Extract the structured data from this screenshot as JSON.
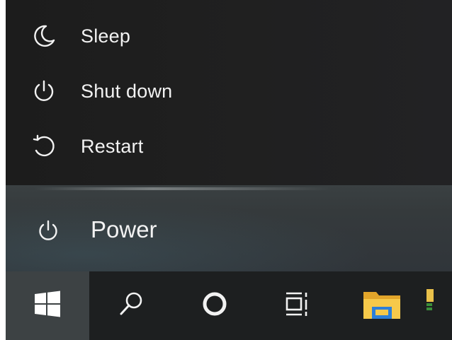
{
  "power_menu": {
    "items": [
      {
        "label": "Sleep",
        "icon": "sleep-moon-icon"
      },
      {
        "label": "Shut down",
        "icon": "power-icon"
      },
      {
        "label": "Restart",
        "icon": "restart-icon"
      }
    ]
  },
  "start_menu": {
    "power_button_label": "Power",
    "power_icon": "power-icon"
  },
  "taskbar": {
    "items": [
      {
        "name": "start",
        "icon": "windows-logo-icon",
        "active": true
      },
      {
        "name": "search",
        "icon": "search-icon"
      },
      {
        "name": "cortana",
        "icon": "cortana-circle-icon"
      },
      {
        "name": "task-view",
        "icon": "task-view-icon"
      },
      {
        "name": "file-explorer",
        "icon": "folder-icon"
      }
    ]
  },
  "colors": {
    "flyout_bg": "#1f1f1f",
    "power_row_bg": "#363b3d",
    "taskbar_bg": "#1d1f20",
    "start_active_bg": "#3d4244",
    "text": "#f2f2f2",
    "folder_yellow": "#f4c33d",
    "folder_blue": "#2c7fd8"
  }
}
